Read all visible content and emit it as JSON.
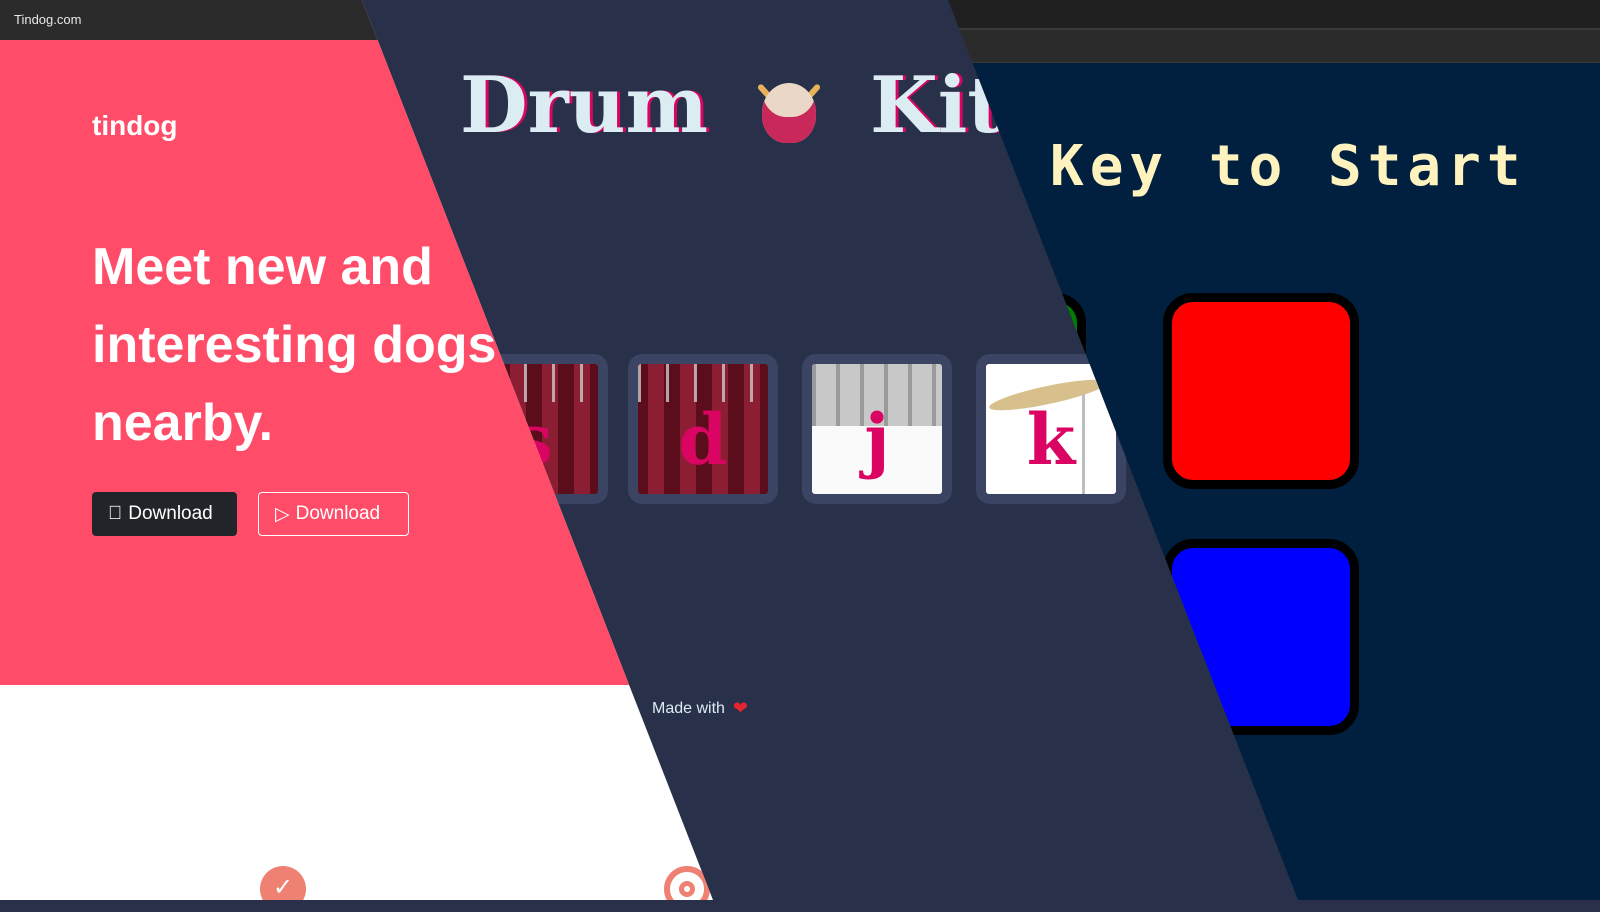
{
  "tindog": {
    "tab_title": "Tindog.com",
    "brand": "tindog",
    "headline": [
      "Meet new and",
      "interesting dogs",
      "nearby."
    ],
    "apple_button": {
      "icon": "apple-icon",
      "label": "Download"
    },
    "play_button": {
      "icon": "play-store-icon",
      "label": "Download"
    },
    "feature_icons": [
      "check-circle-icon",
      "target-icon"
    ],
    "colors": {
      "hero": "#ff4c68",
      "dark_button": "#212529",
      "icon_accent": "#ef8172"
    }
  },
  "drum_kit": {
    "title_left": "Drum",
    "title_right": "Kit",
    "title_icon": "drum-emoji-icon",
    "keys": [
      {
        "letter": "s",
        "drum": "tom"
      },
      {
        "letter": "d",
        "drum": "tom"
      },
      {
        "letter": "j",
        "drum": "snare"
      },
      {
        "letter": "k",
        "drum": "crash-cymbal"
      }
    ],
    "footer_text": "Made with",
    "footer_icon": "heart-icon",
    "colors": {
      "background": "#283149",
      "title": "#dbedf3",
      "accent": "#da0463"
    }
  },
  "simon": {
    "title": "Key to Start",
    "pads": [
      "green",
      "red",
      "blue"
    ],
    "colors": {
      "background": "#011f3f",
      "title": "#fef2bf",
      "green": "#008000",
      "red": "#ff0000",
      "blue": "#0000ff"
    }
  }
}
